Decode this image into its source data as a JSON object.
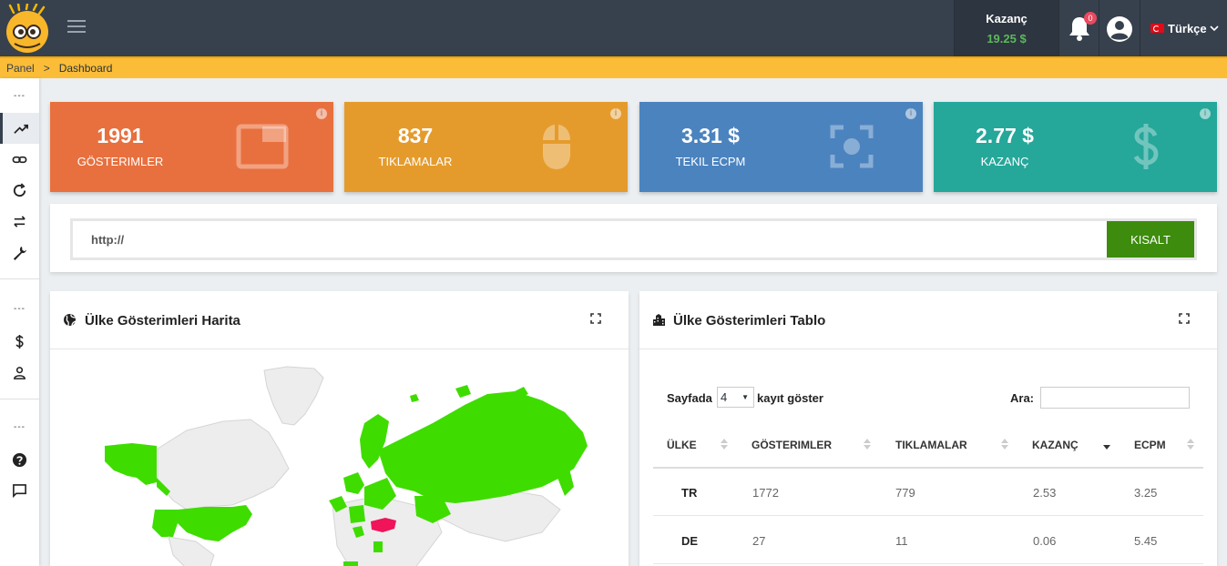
{
  "header": {
    "earnings_label": "Kazanç",
    "earnings_value": "19.25 $",
    "notification_count": "0",
    "language": "Türkçe"
  },
  "breadcrumb": {
    "root": "Panel",
    "separator": ">",
    "current": "Dashboard"
  },
  "sidebar": {
    "group_marker": "---",
    "items": [
      "stats-icon",
      "link-icon",
      "refresh-icon",
      "swap-icon",
      "wrench-icon",
      "dollar-icon",
      "user-icon",
      "help-icon",
      "chat-icon"
    ]
  },
  "stats": [
    {
      "value": "1991",
      "label": "GÖSTERIMLER",
      "color": "#e8703e",
      "icon": "window-icon"
    },
    {
      "value": "837",
      "label": "TIKLAMALAR",
      "color": "#e59b2c",
      "icon": "mouse-icon"
    },
    {
      "value": "3.31 $",
      "label": "TEKIL ECPM",
      "color": "#4b83bf",
      "icon": "focus-icon"
    },
    {
      "value": "2.77 $",
      "label": "KAZANÇ",
      "color": "#25a79a",
      "icon": "dollar-icon"
    }
  ],
  "shortener": {
    "placeholder": "http://",
    "button_label": "KISALT"
  },
  "map_panel": {
    "title": "Ülke Gösterimleri Harita"
  },
  "table_panel": {
    "title": "Ülke Gösterimleri Tablo",
    "show_prefix": "Sayfada",
    "page_size": "4",
    "show_suffix": "kayıt göster",
    "search_label": "Ara:",
    "columns": [
      "ÜLKE",
      "GÖSTERIMLER",
      "TIKLAMALAR",
      "KAZANÇ",
      "ECPM"
    ],
    "rows": [
      {
        "country": "TR",
        "views": "1772",
        "clicks": "779",
        "earnings": "2.53",
        "ecpm": "3.25"
      },
      {
        "country": "DE",
        "views": "27",
        "clicks": "11",
        "earnings": "0.06",
        "ecpm": "5.45"
      }
    ]
  },
  "colors": {
    "topbar": "#37404d",
    "accent": "#fbbd38",
    "positive": "#5cb85c",
    "map_active": "#3fdc00",
    "map_highlight": "#f0145a"
  }
}
